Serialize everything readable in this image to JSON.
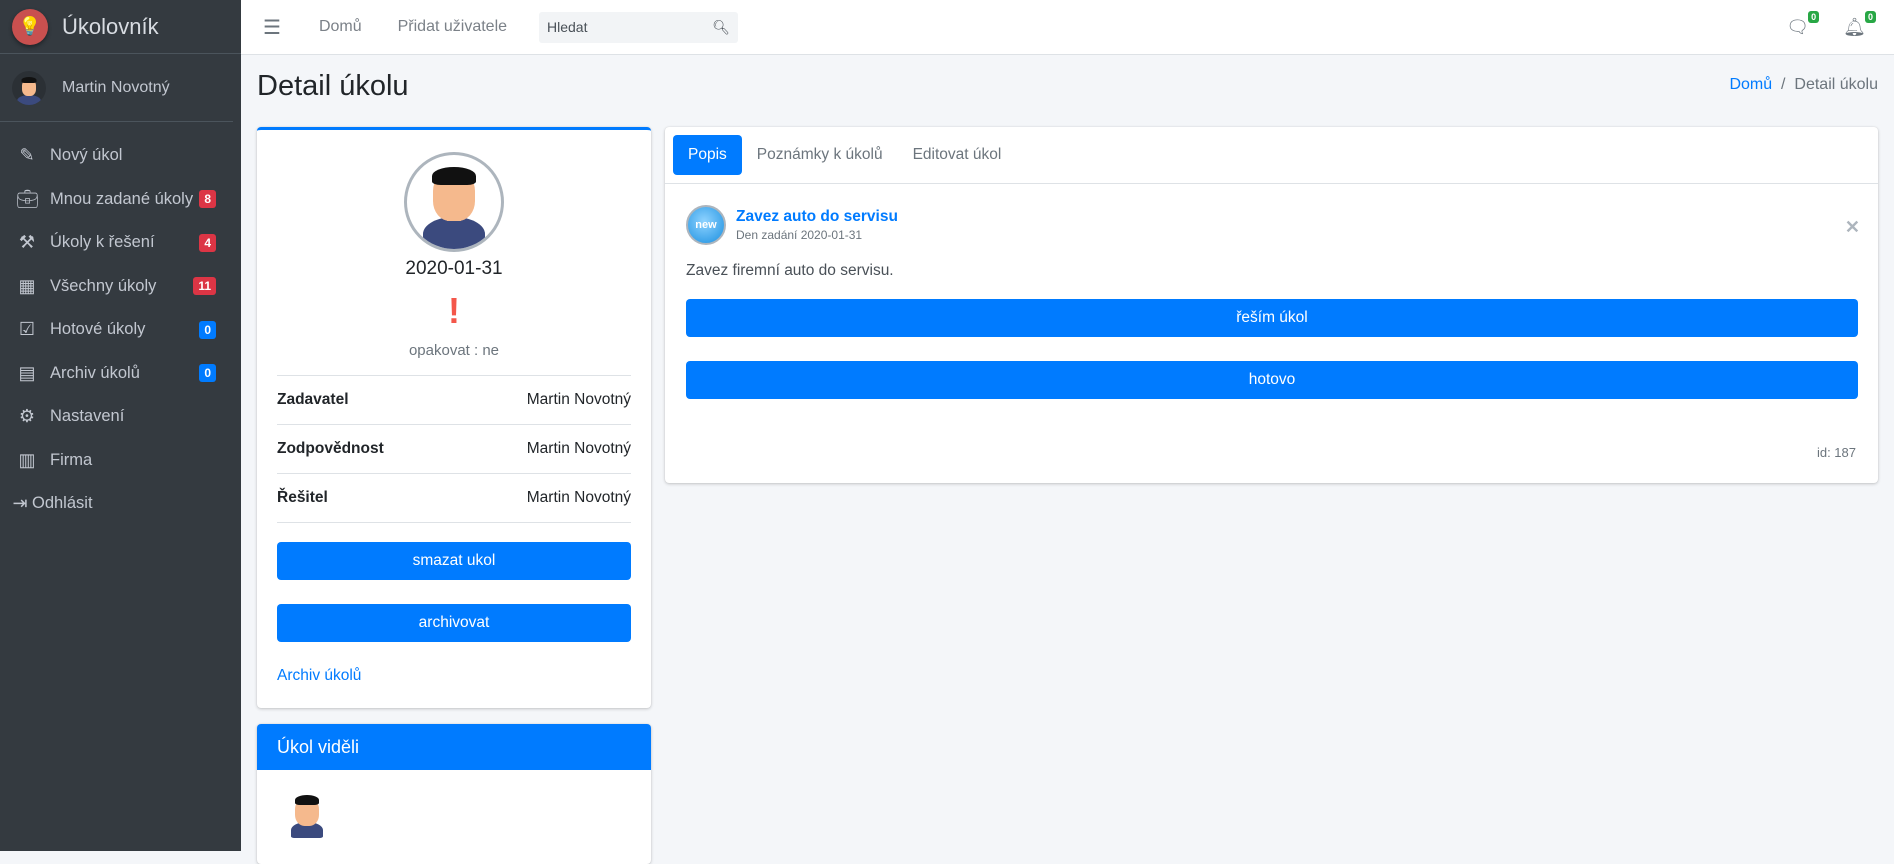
{
  "app": {
    "title": "Úkolovník"
  },
  "sidebar": {
    "user": "Martin Novotný",
    "items": [
      {
        "label": "Nový úkol",
        "icon": "edit-icon"
      },
      {
        "label": "Mnou zadané úkoly",
        "icon": "briefcase-icon",
        "badge": "8",
        "badge_color": "#dc3545"
      },
      {
        "label": "Úkoly k řešení",
        "icon": "hammer-icon",
        "badge": "4",
        "badge_color": "#dc3545"
      },
      {
        "label": "Všechny úkoly",
        "icon": "table-icon",
        "badge": "11",
        "badge_color": "#dc3545"
      },
      {
        "label": "Hotové úkoly",
        "icon": "check-square-icon",
        "badge": "0",
        "badge_color": "#007bff"
      },
      {
        "label": "Archiv úkolů",
        "icon": "archive-icon",
        "badge": "0",
        "badge_color": "#007bff"
      },
      {
        "label": "Nastavení",
        "icon": "cogs-icon"
      },
      {
        "label": "Firma",
        "icon": "building-icon"
      },
      {
        "label": "Odhlásit",
        "icon": "sign-out-icon"
      }
    ]
  },
  "topbar": {
    "home": "Domů",
    "add_user": "Přidat uživatele",
    "search_placeholder": "Hledat",
    "messages_count": "0",
    "notifications_count": "0"
  },
  "page": {
    "title": "Detail úkolu",
    "breadcrumb": [
      "Domů",
      "Detail úkolu"
    ]
  },
  "task_card": {
    "date": "2020-01-31",
    "priority": "!",
    "repeat": "opakovat : ne",
    "rows": [
      {
        "label": "Zadavatel",
        "value": "Martin Novotný"
      },
      {
        "label": "Zodpovědnost",
        "value": "Martin Novotný"
      },
      {
        "label": "Řešitel",
        "value": "Martin Novotný"
      }
    ],
    "delete": "smazat ukol",
    "archive": "archivovat",
    "archive_link": "Archiv úkolů"
  },
  "seen": {
    "title": "Úkol viděli"
  },
  "detail": {
    "tabs": [
      "Popis",
      "Poznámky k úkolů",
      "Editovat úkol"
    ],
    "badge": "new",
    "title": "Zavez auto do servisu",
    "assigned": "Den zadání 2020-01-31",
    "description": "Zavez firemní auto do servisu.",
    "solve": "řeším úkol",
    "done": "hotovo",
    "id": "id: 187"
  },
  "colors": {
    "accent": "#007bff",
    "sidebar": "#343a40",
    "danger": "#dc3545",
    "success": "#28a745"
  }
}
